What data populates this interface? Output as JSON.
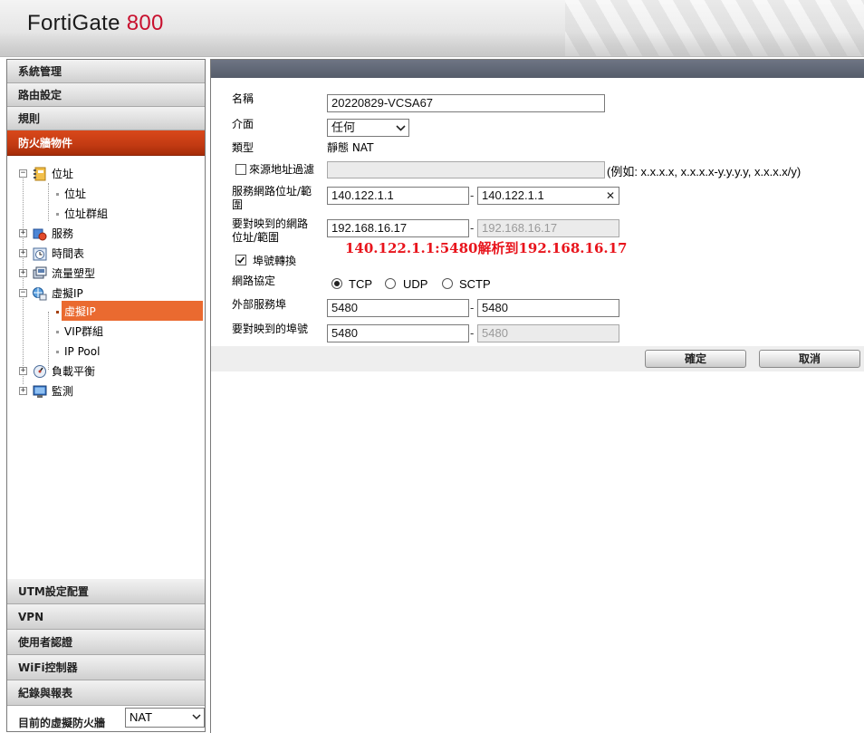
{
  "header": {
    "brand": "FortiGate",
    "model": "800"
  },
  "sidebar": {
    "top_sections": [
      "系統管理",
      "路由設定",
      "規則",
      "防火牆物件"
    ],
    "active_section": "防火牆物件",
    "tree": {
      "address": "位址",
      "address_item": "位址",
      "address_group": "位址群組",
      "service": "服務",
      "schedule": "時間表",
      "traffic_shaper": "流量塑型",
      "virtual_ip": "虛擬IP",
      "virtual_ip_item": "虛擬IP",
      "vip_group": "VIP群組",
      "ip_pool": "IP Pool",
      "load_balance": "負載平衡",
      "monitor": "監測"
    },
    "bottom_sections": [
      "UTM設定配置",
      "VPN",
      "使用者認證",
      "WiFi控制器",
      "紀錄與報表"
    ],
    "vdom_label": "目前的虛擬防火牆",
    "vdom_value": "NAT"
  },
  "form": {
    "name_label": "名稱",
    "name_value": "20220829-VCSA67",
    "interface_label": "介面",
    "interface_value": "任何",
    "type_label": "類型",
    "type_value": "靜態 NAT",
    "source_filter_label": "來源地址過濾",
    "source_filter_checked": false,
    "source_filter_hint": "(例如: x.x.x.x, x.x.x.x-y.y.y.y, x.x.x.x/y)",
    "ext_ip_label_line1": "服務網路位址/範",
    "ext_ip_label_line2": "圍",
    "ext_ip_start": "140.122.1.1",
    "ext_ip_end": "140.122.1.1",
    "mapped_ip_label_line1": "要對映到的網路",
    "mapped_ip_label_line2": "位址/範圍",
    "mapped_ip_start": "192.168.16.17",
    "mapped_ip_end": "192.168.16.17",
    "annotation": "140.122.1.1:5480解析到192.168.16.17",
    "port_forward_label": "埠號轉換",
    "port_forward_checked": true,
    "protocol_label": "網路協定",
    "protocols": [
      "TCP",
      "UDP",
      "SCTP"
    ],
    "protocol_selected": "TCP",
    "ext_port_label": "外部服務埠",
    "ext_port_start": "5480",
    "ext_port_end": "5480",
    "mapped_port_label": "要對映到的埠號",
    "mapped_port_start": "5480",
    "mapped_port_end": "5480",
    "ok_label": "確定",
    "cancel_label": "取消"
  },
  "colors": {
    "active_nav": "#c23a12",
    "selected_tree": "#ea6a30",
    "annotation": "#e8141c",
    "brand_model": "#c8102e"
  }
}
